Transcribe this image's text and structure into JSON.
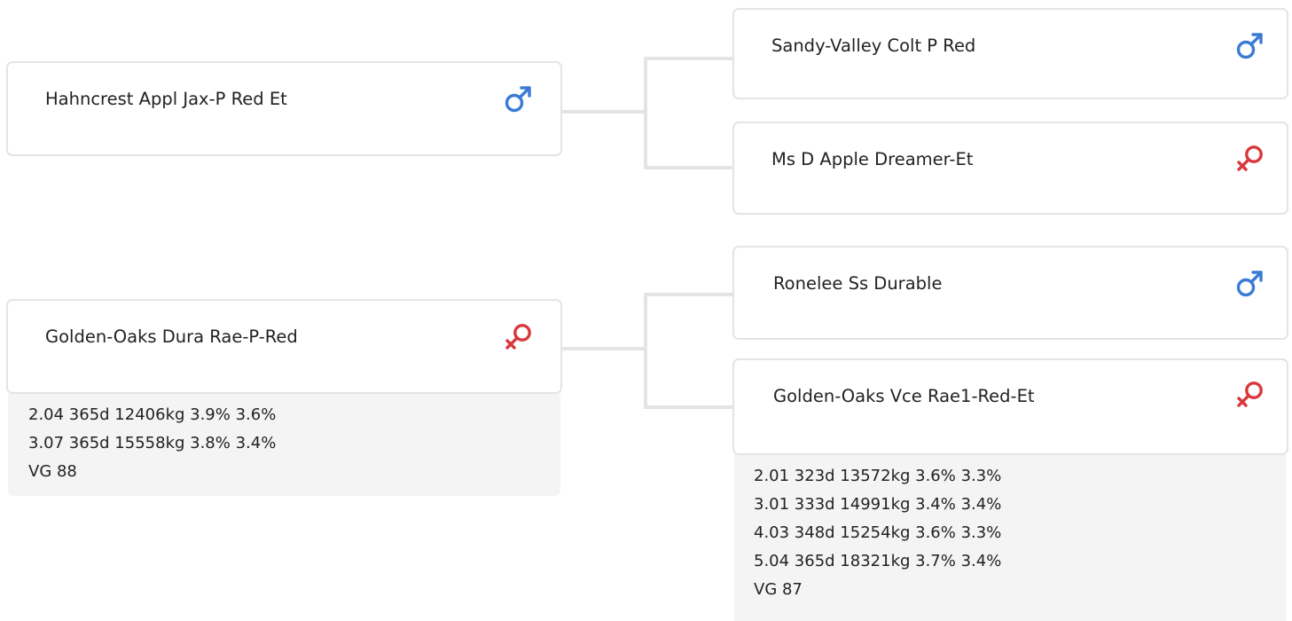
{
  "colors": {
    "male": "#3a7bd5",
    "female": "#d8383d",
    "border": "#e4e4e4",
    "stats_bg": "#f4f4f4"
  },
  "pedigree": {
    "sire": {
      "name": "Hahncrest Appl Jax-P Red Et",
      "sex": "male",
      "sex_icon": "male-icon",
      "sire": {
        "name": "Sandy-Valley Colt P Red",
        "sex": "male",
        "sex_icon": "male-icon"
      },
      "dam": {
        "name": "Ms D Apple Dreamer-Et",
        "sex": "female",
        "sex_icon": "female-icon"
      }
    },
    "dam": {
      "name": "Golden-Oaks Dura Rae-P-Red",
      "sex": "female",
      "sex_icon": "female-icon",
      "records": [
        "2.04 365d 12406kg 3.9% 3.6%",
        "3.07 365d 15558kg 3.8% 3.4%",
        "VG 88"
      ],
      "sire": {
        "name": "Ronelee Ss Durable",
        "sex": "male",
        "sex_icon": "male-icon"
      },
      "dam": {
        "name": "Golden-Oaks Vce Rae1-Red-Et",
        "sex": "female",
        "sex_icon": "female-icon",
        "records": [
          "2.01 323d 13572kg 3.6% 3.3%",
          "3.01 333d 14991kg 3.4% 3.4%",
          "4.03 348d 15254kg 3.6% 3.3%",
          "5.04 365d 18321kg 3.7% 3.4%",
          "VG 87"
        ]
      }
    }
  }
}
